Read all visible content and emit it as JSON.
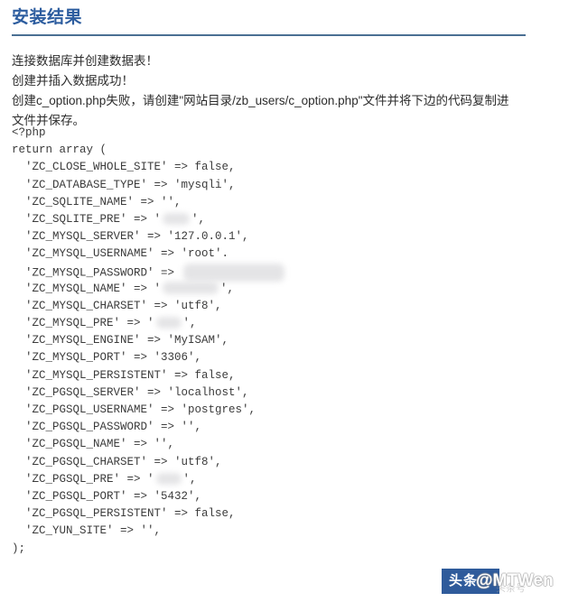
{
  "header": {
    "title": "安装结果",
    "rule_color": "#4a6f93",
    "title_color": "#2d5d9f"
  },
  "messages": {
    "line1": "连接数据库并创建数据表！",
    "line2": "创建并插入数据成功！",
    "line3": "创建c_option.php失败，请创建\"网站目录/zb_users/c_option.php\"文件并将下边的代码复制进文件并保存。"
  },
  "code": {
    "language": "php",
    "lines": [
      {
        "text": "<?php"
      },
      {
        "text": "return array ("
      },
      {
        "text": "  'ZC_CLOSE_WHOLE_SITE' => false,"
      },
      {
        "text": "  'ZC_DATABASE_TYPE' => 'mysqli',"
      },
      {
        "text": "  'ZC_SQLITE_NAME' => '',"
      },
      {
        "prefix": "  'ZC_SQLITE_PRE' => '",
        "redacted": "sqlite-pre",
        "suffix": "',"
      },
      {
        "text": "  'ZC_MYSQL_SERVER' => '127.0.0.1',"
      },
      {
        "text": "  'ZC_MYSQL_USERNAME' => 'root'."
      },
      {
        "prefix": "  'ZC_MYSQL_PASSWORD' => ",
        "redacted": "password",
        "suffix": ""
      },
      {
        "prefix": "  'ZC_MYSQL_NAME' => '",
        "redacted": "mysql-name",
        "suffix": "',"
      },
      {
        "text": "  'ZC_MYSQL_CHARSET' => 'utf8',"
      },
      {
        "prefix": "  'ZC_MYSQL_PRE' => '",
        "redacted": "mysql-pre",
        "suffix": "',"
      },
      {
        "text": "  'ZC_MYSQL_ENGINE' => 'MyISAM',"
      },
      {
        "text": "  'ZC_MYSQL_PORT' => '3306',"
      },
      {
        "text": "  'ZC_MYSQL_PERSISTENT' => false,"
      },
      {
        "text": "  'ZC_PGSQL_SERVER' => 'localhost',"
      },
      {
        "text": "  'ZC_PGSQL_USERNAME' => 'postgres',"
      },
      {
        "text": "  'ZC_PGSQL_PASSWORD' => '',"
      },
      {
        "text": "  'ZC_PGSQL_NAME' => '',"
      },
      {
        "text": "  'ZC_PGSQL_CHARSET' => 'utf8',"
      },
      {
        "prefix": "  'ZC_PGSQL_PRE' => '",
        "redacted": "pgsql-pre",
        "suffix": "',"
      },
      {
        "text": "  'ZC_PGSQL_PORT' => '5432',"
      },
      {
        "text": "  'ZC_PGSQL_PERSISTENT' => false,"
      },
      {
        "text": "  'ZC_YUN_SITE' => '',"
      },
      {
        "text": ");"
      }
    ]
  },
  "watermark": {
    "badge_text": "头条",
    "handle_text": "@MTWen",
    "sub_text": "头条号",
    "badge_color": "#2f5b9b"
  }
}
